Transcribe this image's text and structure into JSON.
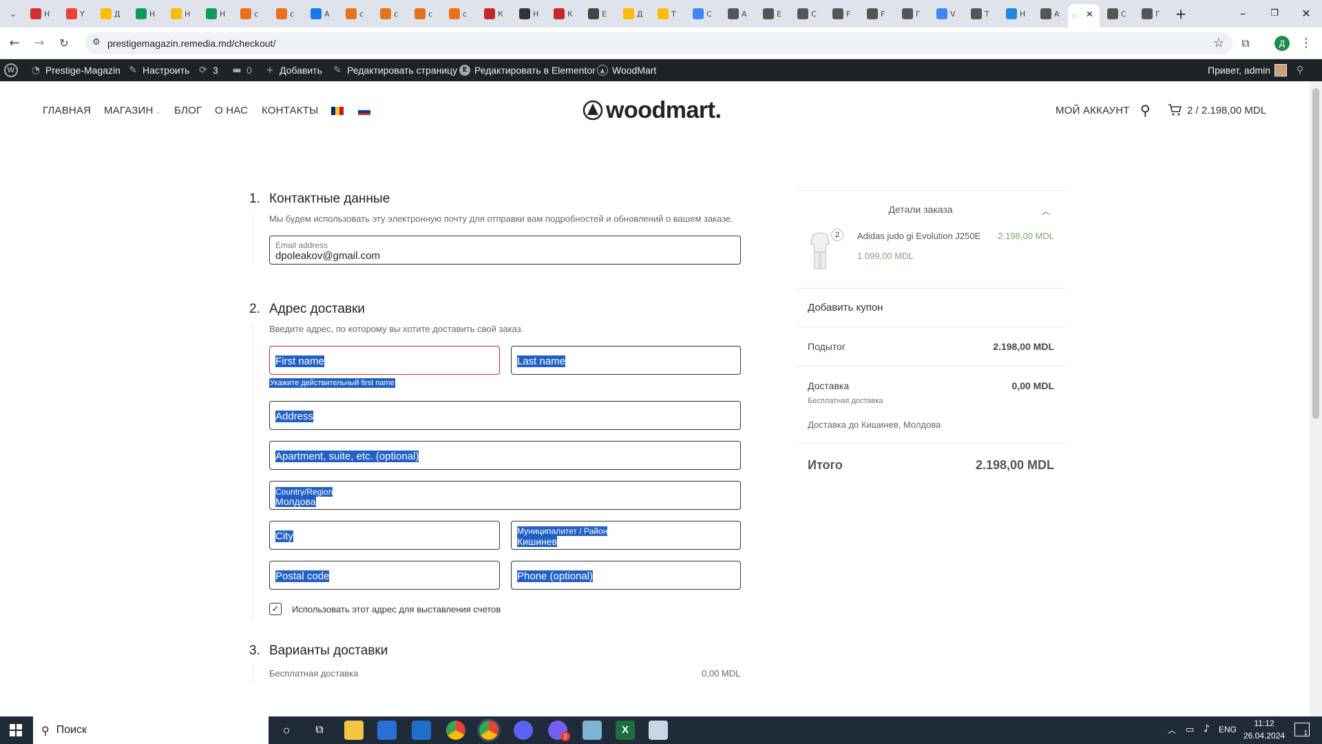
{
  "browser": {
    "tabs": [
      {
        "title": "Н",
        "color": "#d32f2f"
      },
      {
        "title": "Y",
        "color": "#ea4335"
      },
      {
        "title": "Д",
        "color": "#fbbc04"
      },
      {
        "title": "Н",
        "color": "#0f9d58"
      },
      {
        "title": "Н",
        "color": "#fbbc04"
      },
      {
        "title": "Н",
        "color": "#0f9d58"
      },
      {
        "title": "c",
        "color": "#e8711c"
      },
      {
        "title": "c",
        "color": "#e8711c"
      },
      {
        "title": "A",
        "color": "#1877f2"
      },
      {
        "title": "c",
        "color": "#e8711c"
      },
      {
        "title": "c",
        "color": "#e8711c"
      },
      {
        "title": "c",
        "color": "#e8711c"
      },
      {
        "title": "c",
        "color": "#e8711c"
      },
      {
        "title": "К",
        "color": "#c62828"
      },
      {
        "title": "Н",
        "color": "#333333"
      },
      {
        "title": "К",
        "color": "#c62828"
      },
      {
        "title": "E",
        "color": "#444444"
      },
      {
        "title": "Д",
        "color": "#fbbc04"
      },
      {
        "title": "Т",
        "color": "#fbbc04"
      },
      {
        "title": "C",
        "color": "#4285f4"
      },
      {
        "title": "A",
        "color": "#555555"
      },
      {
        "title": "E",
        "color": "#555555"
      },
      {
        "title": "C",
        "color": "#555555"
      },
      {
        "title": "F",
        "color": "#555555"
      },
      {
        "title": "F",
        "color": "#555555"
      },
      {
        "title": "Г",
        "color": "#555555"
      },
      {
        "title": "V",
        "color": "#4285f4"
      },
      {
        "title": "Т",
        "color": "#555555"
      },
      {
        "title": "Н",
        "color": "#1e88e5"
      },
      {
        "title": "A",
        "color": "#555555"
      },
      {
        "title": "C",
        "color": "#555555"
      },
      {
        "title": "Г",
        "color": "#555555"
      },
      {
        "title": "Г",
        "color": "#555555"
      }
    ],
    "url": "prestigemagazin.remedia.md/checkout/",
    "profile_initial": "Д"
  },
  "adminbar": {
    "site": "Prestige-Magazin",
    "customize": "Настроить",
    "updates": "3",
    "comments": "0",
    "add": "Добавить",
    "edit_page": "Редактировать страницу",
    "elementor": "Редактировать в Elementor",
    "woodmart": "WoodMart",
    "greeting": "Привет, admin"
  },
  "header": {
    "menu": [
      "ГЛАВНАЯ",
      "МАГАЗИН",
      "БЛОГ",
      "О НАС",
      "КОНТАКТЫ"
    ],
    "logo": "woodmart.",
    "account": "МОЙ АККАУНТ",
    "cart": "2 / 2.198,00 MDL"
  },
  "checkout": {
    "step1": {
      "num": "1.",
      "title": "Контактные данные",
      "desc": "Мы будем использовать эту электронную почту для отправки вам подробностей и обновлений о вашем заказе.",
      "email_label": "Email address",
      "email_value": "dpoleakov@gmail.com"
    },
    "step2": {
      "num": "2.",
      "title": "Адрес доставки",
      "desc": "Введите адрес, по которому вы хотите доставить свой заказ.",
      "first_name": "First name",
      "last_name": "Last name",
      "error": "Укажите действительный first name",
      "address": "Address",
      "apartment": "Apartment, suite, etc. (optional)",
      "country_label": "Country/Region",
      "country_value": "Молдова",
      "city": "City",
      "district_label": "Муниципалитет / Район",
      "district_value": "Кишинев",
      "postal": "Postal code",
      "phone": "Phone (optional)",
      "billing_checkbox": "Использовать этот адрес для выставления счетов",
      "billing_checked": true
    },
    "step3": {
      "num": "3.",
      "title": "Варианты доставки",
      "option": "Бесплатная доставка",
      "price": "0,00 MDL"
    }
  },
  "summary": {
    "title": "Детали заказа",
    "item_name": "Adidas judo gi Evolution J250E",
    "item_qty": "2",
    "item_total": "2.198,00 MDL",
    "item_unit": "1.099,00 MDL",
    "coupon": "Добавить купон",
    "subtotal_label": "Подытог",
    "subtotal": "2.198,00 MDL",
    "shipping_label": "Доставка",
    "shipping": "0,00 MDL",
    "shipping_method": "Бесплатная доставка",
    "shipping_to": "Доставка до Кишинев, Молдова",
    "total_label": "Итого",
    "total": "2.198,00 MDL"
  },
  "taskbar": {
    "search": "Поиск",
    "lang": "ENG",
    "time": "11:12",
    "date": "26.04.2024",
    "viber_badge": "3",
    "notif": "1"
  }
}
